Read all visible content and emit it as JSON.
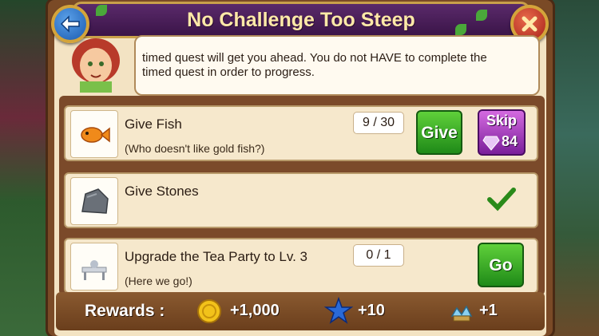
{
  "dialog": {
    "title": "No Challenge Too Steep",
    "intro_line1": "timed quest will get you ahead. You do not HAVE to complete the",
    "intro_line2": "timed quest in order to progress."
  },
  "tasks": [
    {
      "title": "Give Fish",
      "subtitle": "(Who doesn't like gold fish?)",
      "progress": "9 / 30",
      "action_label": "Give",
      "skip_label": "Skip",
      "skip_cost": "84",
      "icon": "goldfish-icon"
    },
    {
      "title": "Give Stones",
      "completed": true,
      "icon": "stone-icon"
    },
    {
      "title": "Upgrade the Tea Party to Lv. 3",
      "subtitle": "(Here we go!)",
      "progress": "0 / 1",
      "action_label": "Go",
      "icon": "tea-party-icon"
    }
  ],
  "rewards": {
    "label": "Rewards :",
    "coins": "+1,000",
    "stars": "+10",
    "item": "+1"
  },
  "colors": {
    "title_bg": "#4a1a5a",
    "green_button": "#2fa82a",
    "purple_button": "#a03ac0",
    "frame": "#7a4a26"
  }
}
